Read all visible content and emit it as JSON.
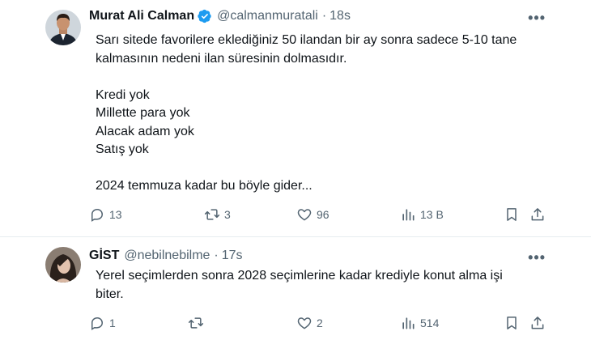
{
  "tweets": [
    {
      "author": {
        "name": "Murat Ali Calman",
        "handle": "@calmanmuratali",
        "verified": true
      },
      "time": "18s",
      "text": "Sarı sitede favorilere eklediğiniz 50 ilandan bir ay sonra sadece 5-10 tane\nkalmasının nedeni ilan süresinin dolmasıdır.\n\nKredi yok\nMillette para yok\nAlacak adam yok\n Satış yok\n\n2024 temmuza kadar bu böyle gider...",
      "stats": {
        "replies": "13",
        "retweets": "3",
        "likes": "96",
        "views": "13 B"
      }
    },
    {
      "author": {
        "name": "GİST",
        "handle": "@nebilnebilme",
        "verified": false
      },
      "time": "17s",
      "text": "Yerel seçimlerden sonra 2028 seçimlerine  kadar krediyle konut alma işi\nbiter.",
      "stats": {
        "replies": "1",
        "retweets": "",
        "likes": "2",
        "views": "514"
      }
    }
  ],
  "separator": "·",
  "more_glyph": "•••",
  "icons": [
    "reply-icon",
    "retweet-icon",
    "like-icon",
    "views-icon",
    "bookmark-icon",
    "share-icon",
    "more-icon",
    "verified-badge-icon"
  ],
  "colors": {
    "text": "#0f1419",
    "secondary": "#536471",
    "verified": "#1d9bf0",
    "border": "#e6ecf0"
  }
}
